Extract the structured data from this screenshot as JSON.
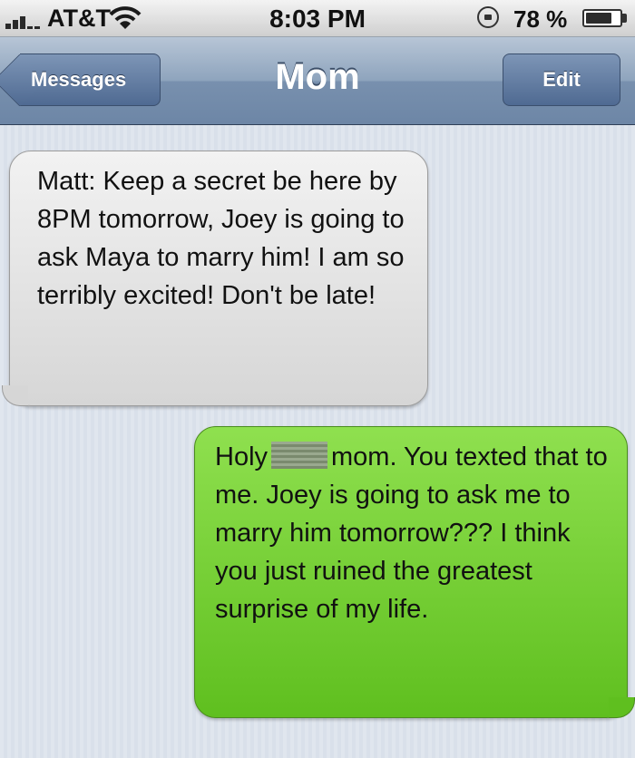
{
  "status_bar": {
    "carrier": "AT&T",
    "time": "8:03 PM",
    "battery_percent": "78 %",
    "battery_level": 0.78,
    "icons": [
      "signal-bars-icon",
      "wifi-icon",
      "rotation-lock-icon",
      "battery-icon"
    ]
  },
  "nav": {
    "back_label": "Messages",
    "title": "Mom",
    "edit_label": "Edit"
  },
  "messages": [
    {
      "direction": "incoming",
      "text": "Matt: Keep a secret be here by 8PM tomorrow, Joey is going to ask Maya to marry him! I am so terribly excited! Don't be late!",
      "color": "#e4e4e4"
    },
    {
      "direction": "outgoing",
      "text_before_redaction": "Holy",
      "text_after_redaction": "mom. You texted that to me. Joey is going to ask me to marry him tomorrow??? I think you just ruined the greatest surprise of my life.",
      "color": "#76cf35"
    }
  ]
}
